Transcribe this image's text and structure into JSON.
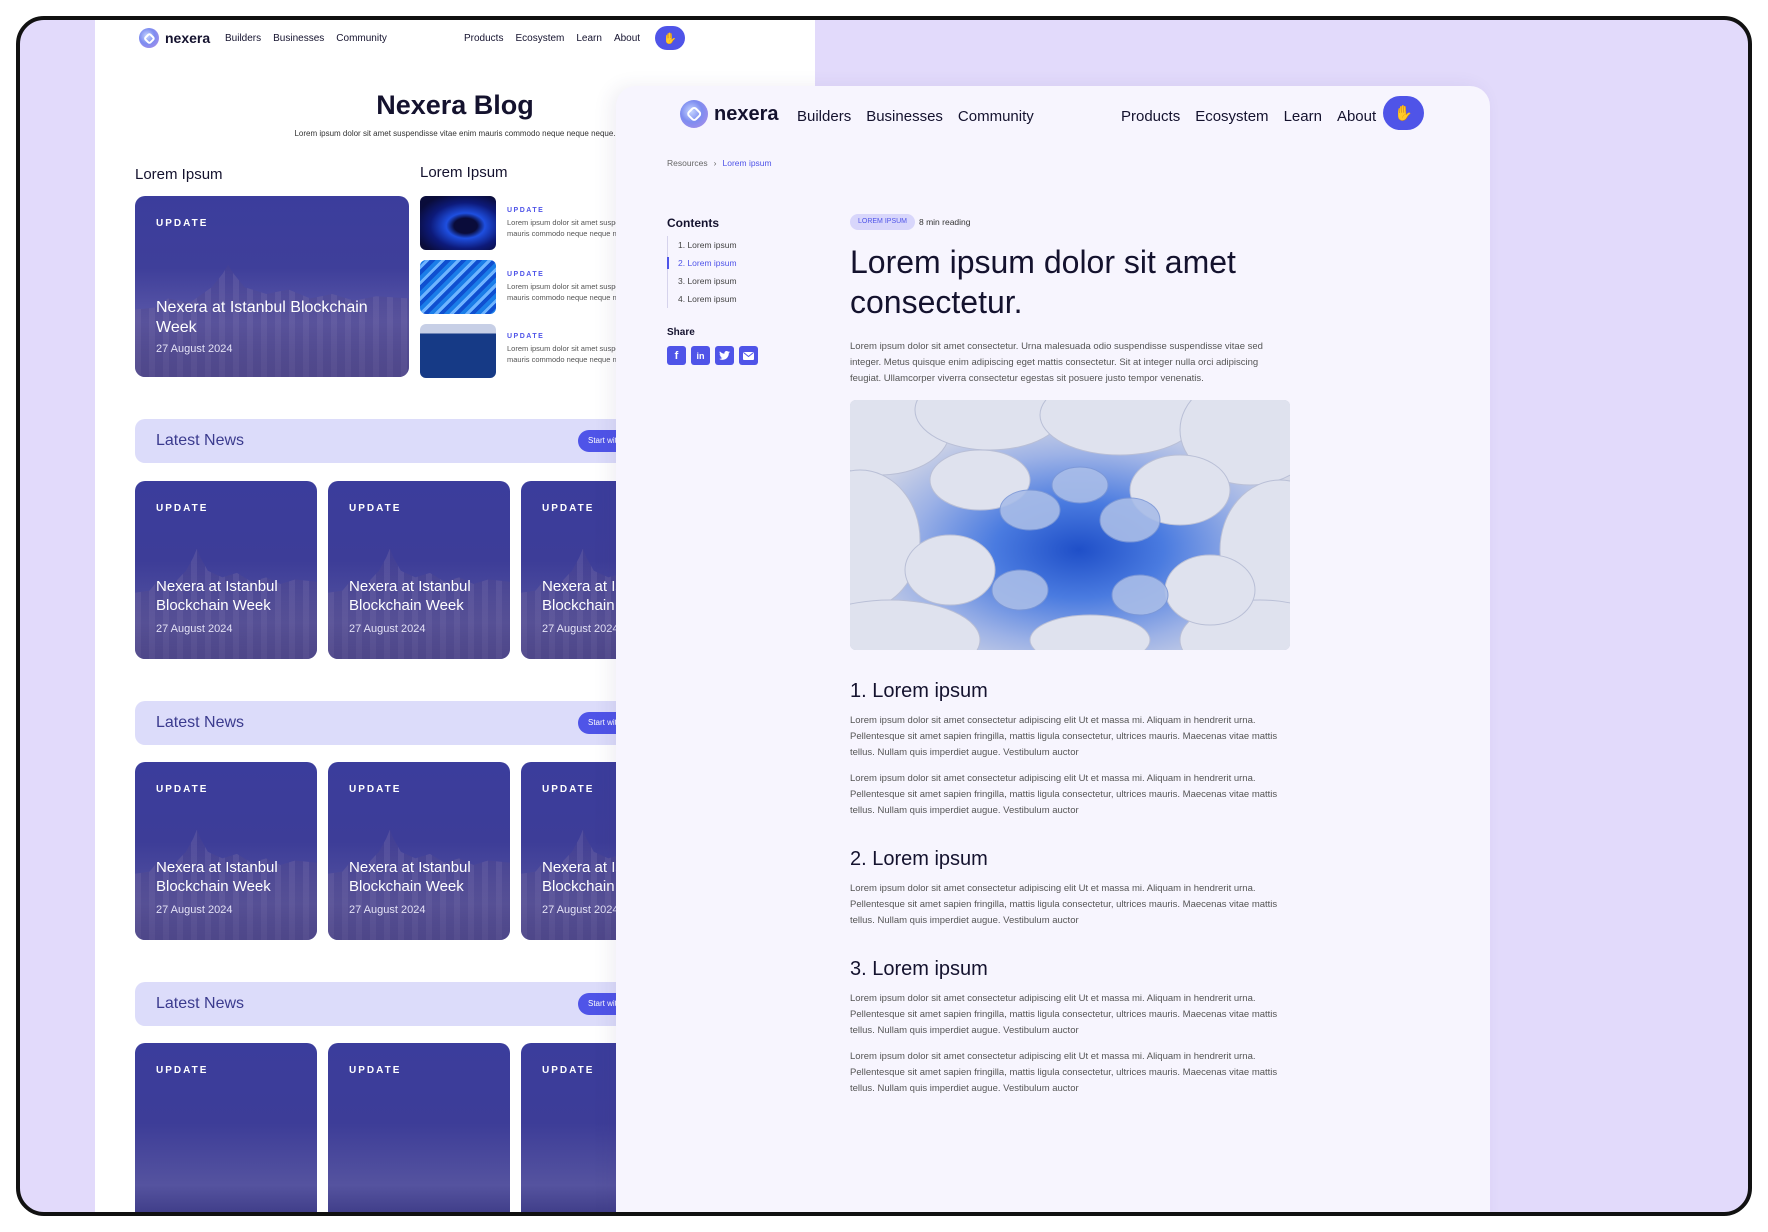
{
  "brand": {
    "name": "nexera"
  },
  "left_page": {
    "nav": {
      "left_links": [
        "Builders",
        "Businesses",
        "Community"
      ],
      "right_links": [
        "Products",
        "Ecosystem",
        "Learn",
        "About"
      ],
      "cta_icon": "waving-hand-icon"
    },
    "title": "Nexera Blog",
    "subtitle": "Lorem ipsum dolor sit amet suspendisse vitae enim mauris commodo neque neque neque.",
    "featured_heading": "Lorem Ipsum",
    "side_heading": "Lorem Ipsum",
    "featured": {
      "tag": "UPDATE",
      "title": "Nexera at Istanbul Blockchain Week",
      "date": "27 August 2024"
    },
    "side_items": [
      {
        "tag": "UPDATE",
        "text1": "Lorem ipsum dolor sit amet suspendisse vitae",
        "text2": "mauris commodo neque neque neque"
      },
      {
        "tag": "UPDATE",
        "text1": "Lorem ipsum dolor sit amet suspendisse vitae",
        "text2": "mauris commodo neque neque neque"
      },
      {
        "tag": "UPDATE",
        "text1": "Lorem ipsum dolor sit amet suspendisse vitae",
        "text2": "mauris commodo neque neque neque"
      }
    ],
    "news_sections": [
      {
        "title": "Latest News",
        "button": "Start with Nexera",
        "cards": [
          {
            "tag": "UPDATE",
            "title": "Nexera at Istanbul Blockchain Week",
            "date": "27 August 2024"
          },
          {
            "tag": "UPDATE",
            "title": "Nexera at Istanbul Blockchain Week",
            "date": "27 August 2024"
          },
          {
            "tag": "UPDATE",
            "title": "Nexera at Istanbul Blockchain Week",
            "date": "27 August 2024"
          }
        ]
      },
      {
        "title": "Latest News",
        "button": "Start with Nexera",
        "cards": [
          {
            "tag": "UPDATE",
            "title": "Nexera at Istanbul Blockchain Week",
            "date": "27 August 2024"
          },
          {
            "tag": "UPDATE",
            "title": "Nexera at Istanbul Blockchain Week",
            "date": "27 August 2024"
          },
          {
            "tag": "UPDATE",
            "title": "Nexera at Istanbul Blockchain Week",
            "date": "27 August 2024"
          }
        ]
      },
      {
        "title": "Latest News",
        "button": "Start with Nexera",
        "cards": [
          {
            "tag": "UPDATE"
          },
          {
            "tag": "UPDATE"
          },
          {
            "tag": "UPDATE"
          }
        ]
      }
    ]
  },
  "right_page": {
    "nav": {
      "left_links": [
        "Builders",
        "Businesses",
        "Community"
      ],
      "right_links": [
        "Products",
        "Ecosystem",
        "Learn",
        "About"
      ],
      "cta_icon": "waving-hand-icon"
    },
    "breadcrumb": {
      "root": "Resources",
      "current": "Lorem ipsum"
    },
    "contents": {
      "heading": "Contents",
      "items": [
        "1. Lorem ipsum",
        "2. Lorem ipsum",
        "3. Lorem ipsum",
        "4. Lorem ipsum"
      ],
      "active_index": 1
    },
    "share": {
      "heading": "Share",
      "icons": [
        "facebook-icon",
        "linkedin-icon",
        "twitter-icon",
        "email-icon"
      ]
    },
    "badge": "LOREM IPSUM",
    "reading_time": "8 min reading",
    "article_title": "Lorem ipsum dolor sit amet consectetur.",
    "intro": "Lorem ipsum dolor sit amet consectetur. Urna malesuada odio suspendisse suspendisse vitae sed integer. Metus quisque enim adipiscing eget mattis consectetur. Sit at integer nulla orci adipiscing feugiat. Ullamcorper viverra consectetur egestas sit posuere justo tempor venenatis.",
    "sections": [
      {
        "heading": "1. Lorem ipsum",
        "paragraphs": [
          "Lorem ipsum dolor sit amet consectetur adipiscing elit Ut et massa mi. Aliquam in hendrerit urna. Pellentesque sit amet sapien fringilla, mattis ligula consectetur, ultrices mauris. Maecenas vitae mattis tellus. Nullam quis imperdiet augue. Vestibulum auctor",
          "Lorem ipsum dolor sit amet consectetur adipiscing elit Ut et massa mi. Aliquam in hendrerit urna. Pellentesque sit amet sapien fringilla, mattis ligula consectetur, ultrices mauris. Maecenas vitae mattis tellus. Nullam quis imperdiet augue. Vestibulum auctor"
        ]
      },
      {
        "heading": "2. Lorem ipsum",
        "paragraphs": [
          "Lorem ipsum dolor sit amet consectetur adipiscing elit Ut et massa mi. Aliquam in hendrerit urna. Pellentesque sit amet sapien fringilla, mattis ligula consectetur, ultrices mauris. Maecenas vitae mattis tellus. Nullam quis imperdiet augue. Vestibulum auctor"
        ]
      },
      {
        "heading": "3. Lorem ipsum",
        "paragraphs": [
          "Lorem ipsum dolor sit amet consectetur adipiscing elit Ut et massa mi. Aliquam in hendrerit urna. Pellentesque sit amet sapien fringilla, mattis ligula consectetur, ultrices mauris. Maecenas vitae mattis tellus. Nullam quis imperdiet augue. Vestibulum auctor",
          "Lorem ipsum dolor sit amet consectetur adipiscing elit Ut et massa mi. Aliquam in hendrerit urna. Pellentesque sit amet sapien fringilla, mattis ligula consectetur, ultrices mauris. Maecenas vitae mattis tellus. Nullam quis imperdiet augue. Vestibulum auctor"
        ]
      }
    ]
  },
  "colors": {
    "accent": "#4f54e8",
    "background": "#e2dafb",
    "card": "#3b3d9c",
    "news_bar": "#dcdcfa"
  }
}
